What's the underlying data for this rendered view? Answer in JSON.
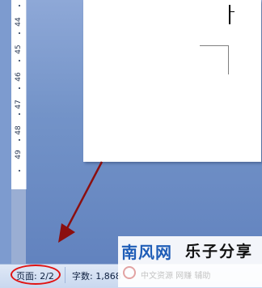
{
  "ruler": {
    "numbers": [
      "44",
      "45",
      "46",
      "47",
      "48",
      "49"
    ]
  },
  "status_bar": {
    "page": "页面: 2/2",
    "words": "字数: 1,868"
  },
  "watermark": {
    "title_blue": "南风网",
    "title_black": "乐子分享",
    "subtitle": "中文资源 网赚 辅助"
  },
  "colors": {
    "workspace": "#6f8fc7",
    "page": "#ffffff",
    "highlight": "#e11414",
    "arrow": "#8b0f0f",
    "brand_blue": "#1f5db7"
  }
}
